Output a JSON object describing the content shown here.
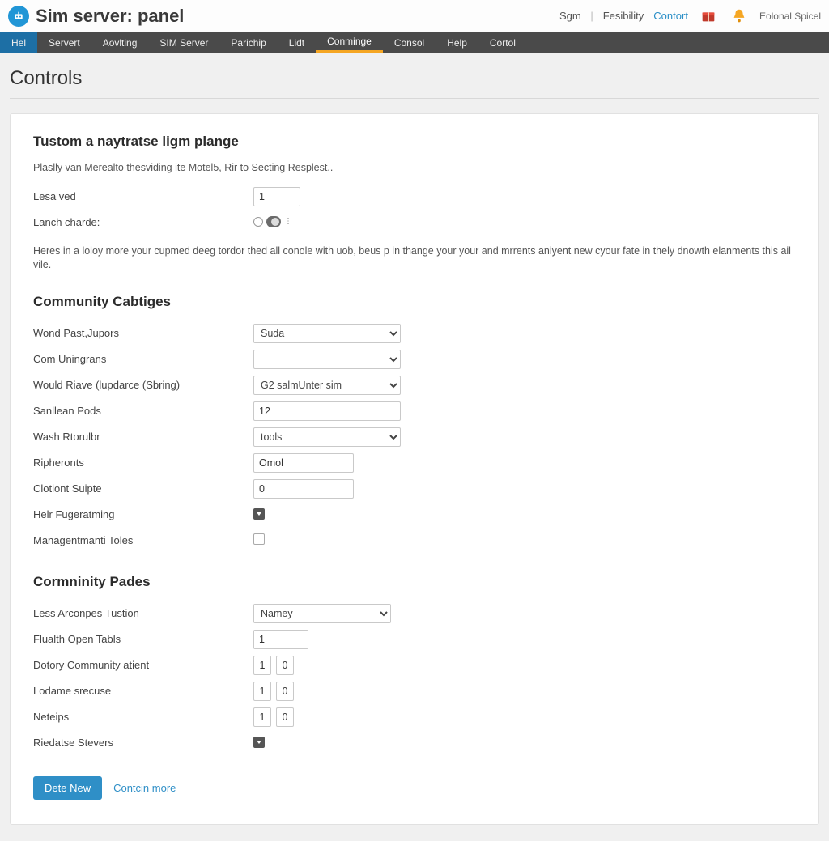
{
  "header": {
    "app_title": "Sim server: panel",
    "links": {
      "sign": "Sgm",
      "fesibility": "Fesibility",
      "contort": "Contort",
      "eolonal": "Eolonal Spicel"
    }
  },
  "nav": {
    "items": [
      "Hel",
      "Servert",
      "Aovlting",
      "SIM Server",
      "Parichip",
      "Lidt",
      "Conminge",
      "Consol",
      "Help",
      "Cortol"
    ],
    "active_index": 6
  },
  "page": {
    "title": "Controls",
    "section1": {
      "heading": "Tustom a naytratse ligm plange",
      "desc": "Plaslly van Merealto thesviding ite Motel5, Rir to Secting Resplest..",
      "rows": {
        "lesa_ved": {
          "label": "Lesa ved",
          "value": "1"
        },
        "lanch_charde": {
          "label": "Lanch charde:"
        }
      },
      "help": "Heres in a loloy more your cupmed deeg tordor thed all conole with uob, beus p in thange your your and mrrents aniyent new cyour fate in thely dnowth elanments this ail vile."
    },
    "section2": {
      "heading": "Community Cabtiges",
      "rows": {
        "wond_past": {
          "label": "Wond Past,Jupors",
          "value": "Suda"
        },
        "com_uningrans": {
          "label": "Com Uningrans",
          "value": ""
        },
        "would_rave": {
          "label": "Would Riave (lupdarce (Sbring)",
          "value": "G2 salmUnter sim"
        },
        "sanllean_pods": {
          "label": "Sanllean Pods",
          "value": "12"
        },
        "wash_rtorulbr": {
          "label": "Wash Rtorulbr",
          "value": "tools"
        },
        "ripheronts": {
          "label": "Ripheronts",
          "value": "Omol"
        },
        "clotiont_suipte": {
          "label": "Clotiont Suipte",
          "value": "0"
        },
        "helr_fuger": {
          "label": "Helr Fugeratming",
          "checked": true
        },
        "mgmt_toles": {
          "label": "Managentmanti Toles",
          "checked": false
        }
      }
    },
    "section3": {
      "heading": "Cormninity Pades",
      "rows": {
        "less_arconpes": {
          "label": "Less Arconpes Tustion",
          "value": "Namey"
        },
        "flualth_open": {
          "label": "Flualth Open Tabls",
          "value": "1"
        },
        "dotory_comm": {
          "label": "Dotory Community atient",
          "a": "1",
          "b": "0"
        },
        "lodame_srecuse": {
          "label": "Lodame srecuse",
          "a": "1",
          "b": "0"
        },
        "neteips": {
          "label": "Neteips",
          "a": "1",
          "b": "0"
        },
        "riedatse": {
          "label": "Riedatse Stevers",
          "checked": true
        }
      }
    },
    "actions": {
      "primary": "Dete New",
      "more": "Contcin more"
    }
  }
}
